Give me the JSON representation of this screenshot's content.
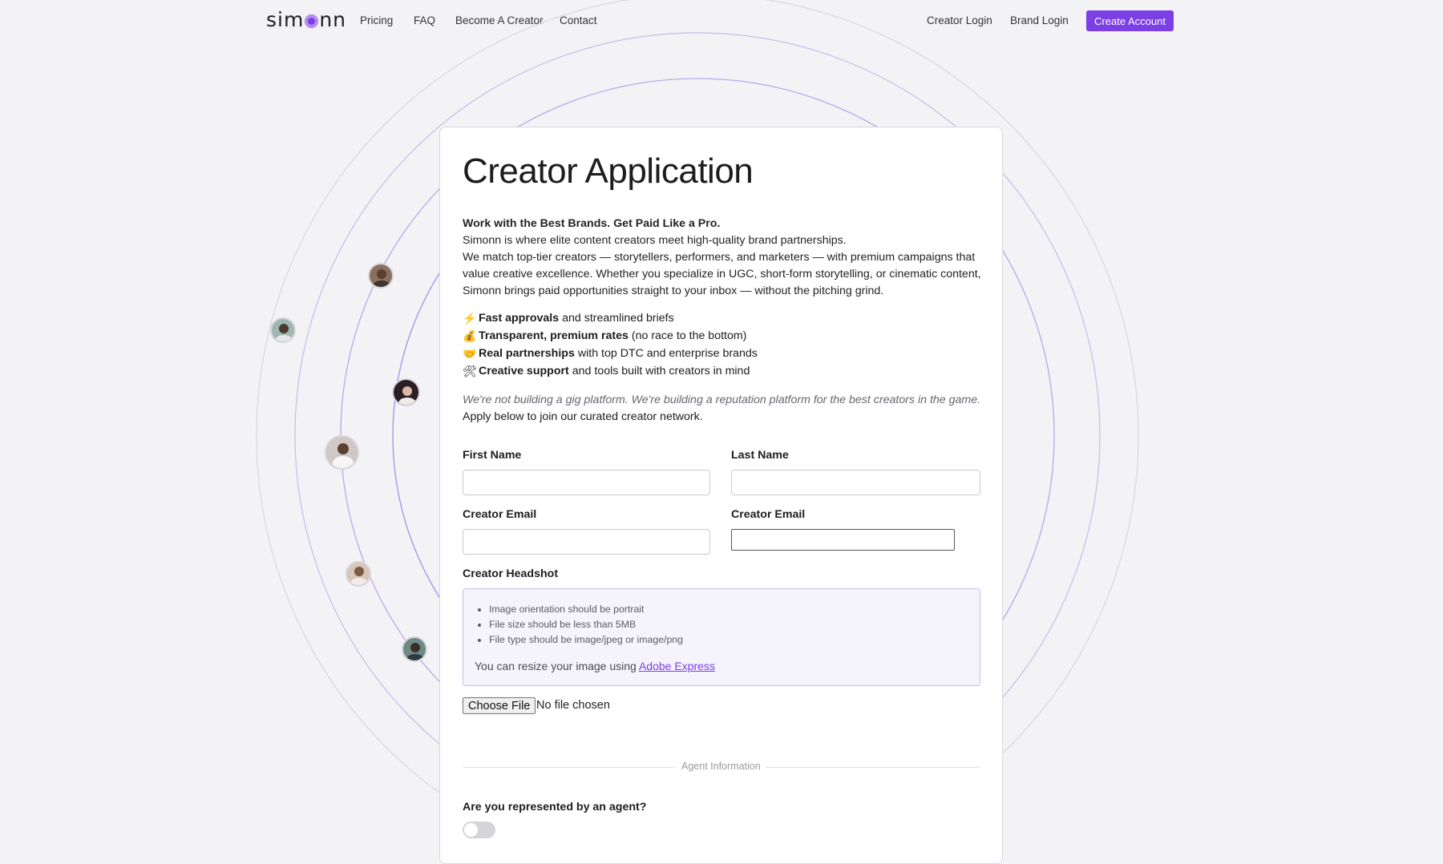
{
  "nav": {
    "logo": "simonn",
    "links": [
      "Pricing",
      "FAQ",
      "Become A Creator",
      "Contact"
    ],
    "creator_login": "Creator Login",
    "brand_login": "Brand Login",
    "create_account": "Create Account"
  },
  "colors": {
    "accent": "#7b3fe4",
    "background": "#f3f2f4",
    "card": "#ffffff"
  },
  "form": {
    "title": "Creator Application",
    "headline": "Work with the Best Brands. Get Paid Like a Pro.",
    "intro_line1": "Simonn is where elite content creators meet high-quality brand partnerships.",
    "intro_line2": "We match top-tier creators — storytellers, performers, and marketers — with premium campaigns that value creative excellence. Whether you specialize in UGC, short-form storytelling, or cinematic content, Simonn brings paid opportunities straight to your inbox — without the pitching grind.",
    "features": [
      {
        "icon": "lightning-icon",
        "glyph": "⚡",
        "bold": "Fast approvals",
        "rest": "and streamlined briefs"
      },
      {
        "icon": "money-bag-icon",
        "glyph": "💰",
        "bold": "Transparent, premium rates",
        "rest": "(no race to the bottom)"
      },
      {
        "icon": "handshake-icon",
        "glyph": "🤝",
        "bold": "Real partnerships",
        "rest": "with top DTC and enterprise brands"
      },
      {
        "icon": "tools-icon",
        "glyph": "🛠",
        "bold": "Creative support",
        "rest": "and tools built with creators in mind"
      }
    ],
    "tagline_italic": "We're not building a gig platform. We're building a reputation platform for the best creators in the game.",
    "tagline_plain": "Apply below to join our curated creator network.",
    "first_name_label": "First Name",
    "first_name_value": "",
    "last_name_label": "Last Name",
    "last_name_value": "",
    "creator_email_label": "Creator Email",
    "creator_email_value": "",
    "creator_email2_label": "Creator Email",
    "creator_email2_value": "",
    "headshot_label": "Creator Headshot",
    "headshot_rules": [
      "Image orientation should be portrait",
      "File size should be less than 5MB",
      "File type should be image/jpeg or image/png"
    ],
    "resize_text": "You can resize your image using",
    "resize_link": "Adobe Express",
    "choose_file": "Choose File",
    "no_file": "No file chosen",
    "agent_section": "Agent Information",
    "agent_question": "Are you represented by an agent?",
    "agent_toggle": false
  }
}
